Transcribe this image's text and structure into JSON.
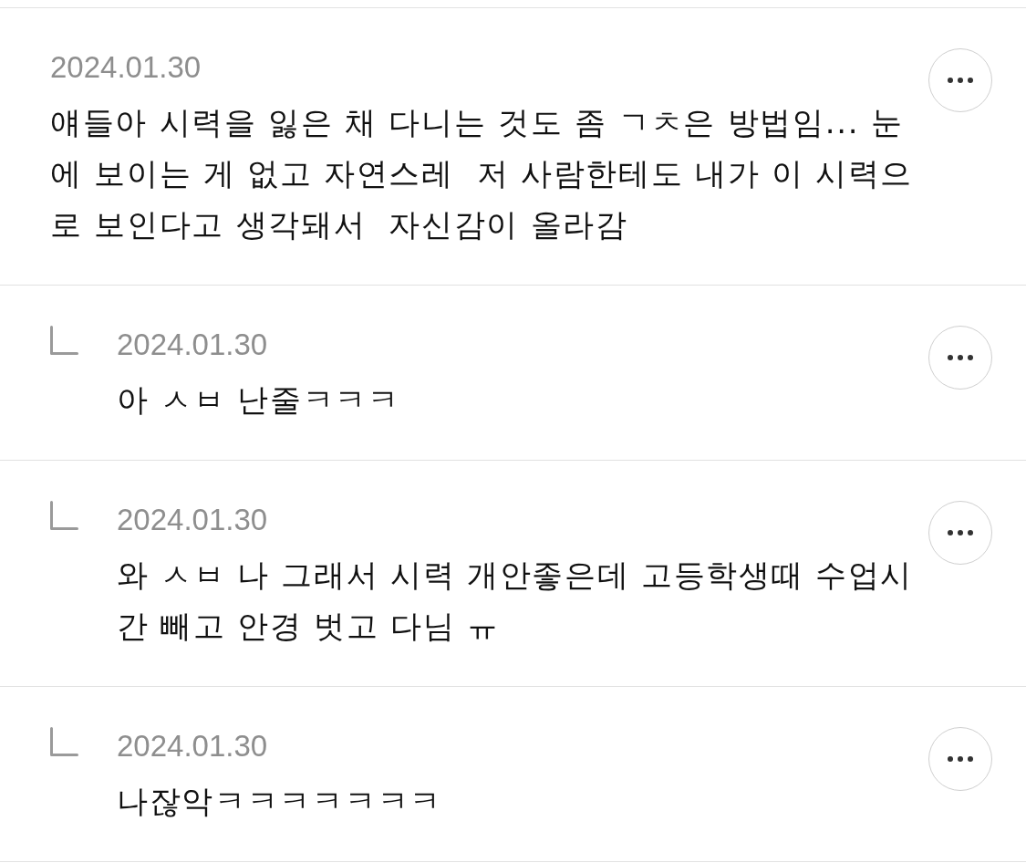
{
  "comments": [
    {
      "date": "2024.01.30",
      "text": "얘들아 시력을 잃은 채 다니는 것도 좀 ㄱㅊ은 방법임... 눈에 보이는 게 없고 자연스레  저 사람한테도 내가 이 시력으로 보인다고 생각돼서  자신감이 올라감",
      "replies": [
        {
          "date": "2024.01.30",
          "text": "아 ㅅㅂ 난줄ㅋㅋㅋ"
        },
        {
          "date": "2024.01.30",
          "text": "와 ㅅㅂ 나 그래서 시력 개안좋은데 고등학생때 수업시간 빼고 안경 벗고 다님 ㅠ"
        },
        {
          "date": "2024.01.30",
          "text": "나잖악ㅋㅋㅋㅋㅋㅋㅋ"
        }
      ]
    }
  ]
}
